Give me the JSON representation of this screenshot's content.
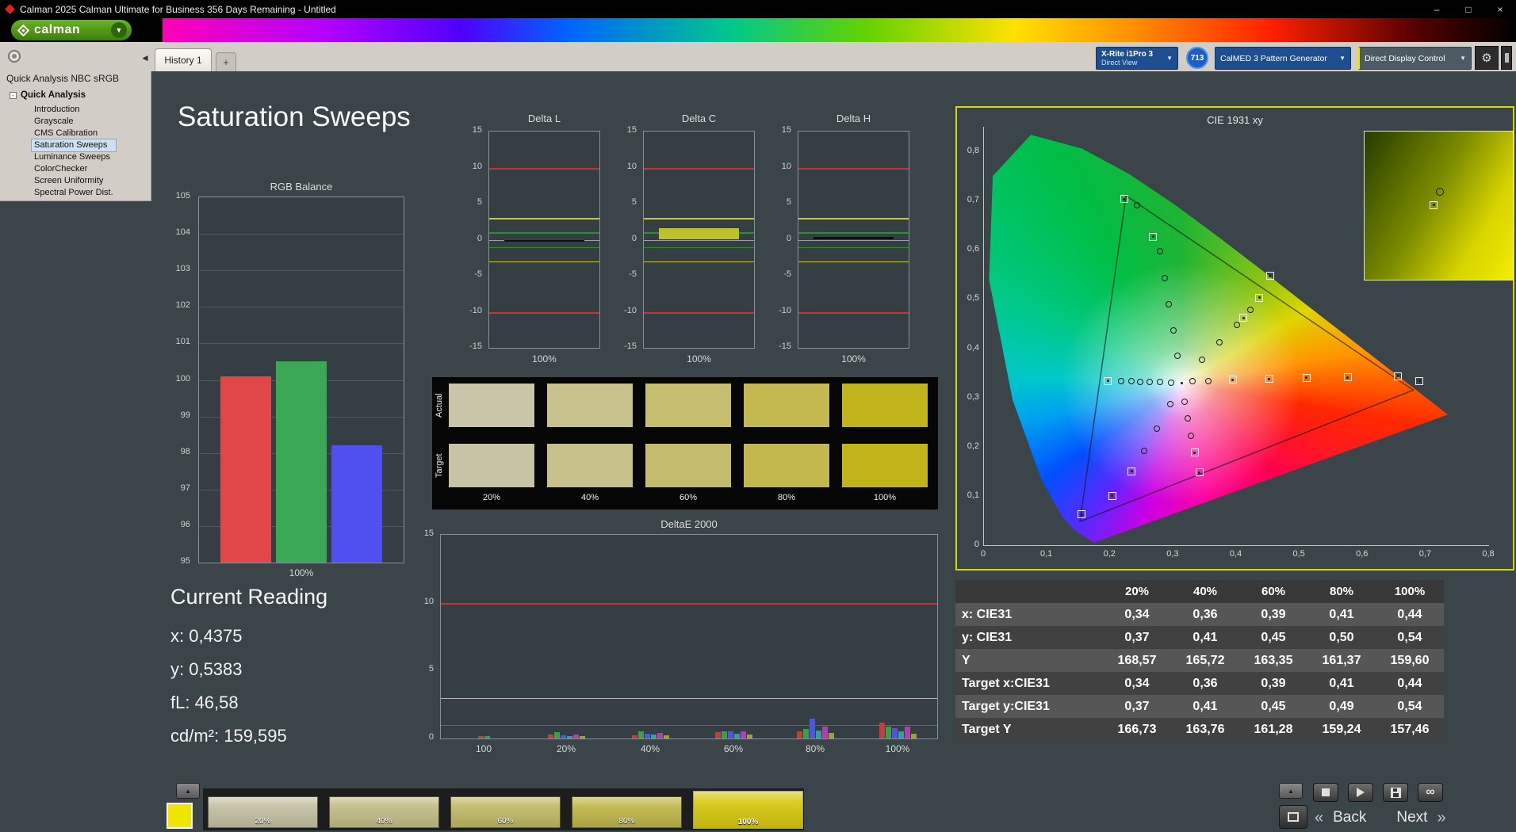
{
  "window": {
    "title": "Calman 2025 Calman Ultimate for Business 356 Days Remaining  - Untitled",
    "minimize": "–",
    "maximize": "□",
    "close": "×"
  },
  "brand": {
    "name": "calman"
  },
  "tabs": {
    "active": "History 1",
    "add": "+"
  },
  "toolbar": {
    "meter_line1": "X-Rite i1Pro 3",
    "meter_line2": "Direct View",
    "meter_badge": "713",
    "pattern_generator": "CalMED 3 Pattern Generator",
    "display_control": "Direct Display Control"
  },
  "glyphs": {
    "caret": "▼",
    "collapse_left": "◄",
    "up_arrow": "▲",
    "infinity": "∞",
    "back_chevron": "«",
    "next_chevron": "»",
    "tree_expander": "-",
    "gear": "⚙"
  },
  "sidebar": {
    "header": "Quick Analysis NBC sRGB",
    "root": "Quick Analysis",
    "items": [
      "Introduction",
      "Grayscale",
      "CMS Calibration",
      "Saturation Sweeps",
      "Luminance Sweeps",
      "ColorChecker",
      "Screen Uniformity",
      "Spectral Power Dist."
    ],
    "selected": "Saturation Sweeps"
  },
  "page": {
    "title": "Saturation Sweeps"
  },
  "current_reading": {
    "heading": "Current Reading",
    "lines": [
      "x: 0,4375",
      "y: 0,5383",
      "fL: 46,58",
      "cd/m²: 159,595"
    ]
  },
  "swatch_panel": {
    "row_labels": [
      "Actual",
      "Target"
    ],
    "col_labels": [
      "20%",
      "40%",
      "60%",
      "80%",
      "100%"
    ],
    "actual_colors": [
      "#c8c5a9",
      "#c7c18d",
      "#c5bd6f",
      "#c4b951",
      "#c2b41c"
    ],
    "target_colors": [
      "#c7c4a6",
      "#c6c08a",
      "#c4bc6c",
      "#c3b84e",
      "#c1b31a"
    ]
  },
  "measurement_table": {
    "columns": [
      "20%",
      "40%",
      "60%",
      "80%",
      "100%"
    ],
    "rows": [
      {
        "label": "x: CIE31",
        "values": [
          "0,34",
          "0,36",
          "0,39",
          "0,41",
          "0,44"
        ]
      },
      {
        "label": "y: CIE31",
        "values": [
          "0,37",
          "0,41",
          "0,45",
          "0,50",
          "0,54"
        ]
      },
      {
        "label": "Y",
        "values": [
          "168,57",
          "165,72",
          "163,35",
          "161,37",
          "159,60"
        ]
      },
      {
        "label": "Target x:CIE31",
        "values": [
          "0,34",
          "0,36",
          "0,39",
          "0,41",
          "0,44"
        ]
      },
      {
        "label": "Target y:CIE31",
        "values": [
          "0,37",
          "0,41",
          "0,45",
          "0,49",
          "0,54"
        ]
      },
      {
        "label": "Target Y",
        "values": [
          "166,73",
          "163,76",
          "161,28",
          "159,24",
          "157,46"
        ]
      }
    ]
  },
  "bottom_bar": {
    "swatch_color": "#efe600",
    "patches": [
      {
        "label": "20%",
        "color": "#c3c0a2",
        "selected": false
      },
      {
        "label": "40%",
        "color": "#c2bd85",
        "selected": false
      },
      {
        "label": "60%",
        "color": "#c0b967",
        "selected": false
      },
      {
        "label": "80%",
        "color": "#bfb54a",
        "selected": false
      },
      {
        "label": "100%",
        "color": "#d6c70e",
        "selected": true
      }
    ],
    "back": "Back",
    "next": "Next"
  },
  "chart_data": [
    {
      "id": "rgb_balance",
      "type": "bar",
      "title": "RGB Balance",
      "categories": [
        "Red",
        "Green",
        "Blue"
      ],
      "values": [
        100.1,
        100.5,
        98.2
      ],
      "colors": [
        "#e04848",
        "#3aa855",
        "#5050f0"
      ],
      "ylim": [
        95,
        105
      ],
      "yticks": [
        105,
        104,
        103,
        102,
        101,
        100,
        99,
        98,
        97,
        96,
        95
      ],
      "xlabel": "100%"
    },
    {
      "id": "delta_l",
      "type": "bar",
      "title": "Delta L",
      "ylim": [
        -15,
        15
      ],
      "yticks": [
        15,
        10,
        5,
        0,
        -5,
        -10,
        -15
      ],
      "limit_lines": [
        {
          "y": 10,
          "color": "#c83232"
        },
        {
          "y": -10,
          "color": "#c83232"
        },
        {
          "y": 3,
          "color": "#c8c832"
        },
        {
          "y": -3,
          "color": "#c8c832"
        },
        {
          "y": 1,
          "color": "#2e8b2e"
        },
        {
          "y": -1,
          "color": "#2e8b2e"
        }
      ],
      "value": -0.3,
      "bar_color": "#101010",
      "xlabel": "100%"
    },
    {
      "id": "delta_c",
      "type": "bar",
      "title": "Delta C",
      "ylim": [
        -15,
        15
      ],
      "yticks": [
        15,
        10,
        5,
        0,
        -5,
        -10,
        -15
      ],
      "limit_lines": [
        {
          "y": 10,
          "color": "#c83232"
        },
        {
          "y": -10,
          "color": "#c83232"
        },
        {
          "y": 3,
          "color": "#c8c832"
        },
        {
          "y": -3,
          "color": "#c8c832"
        },
        {
          "y": 1,
          "color": "#2e8b2e"
        },
        {
          "y": -1,
          "color": "#2e8b2e"
        }
      ],
      "value": 1.6,
      "bar_color": "#bcc22e",
      "xlabel": "100%"
    },
    {
      "id": "delta_h",
      "type": "bar",
      "title": "Delta H",
      "ylim": [
        -15,
        15
      ],
      "yticks": [
        15,
        10,
        5,
        0,
        -5,
        -10,
        -15
      ],
      "limit_lines": [
        {
          "y": 10,
          "color": "#c83232"
        },
        {
          "y": -10,
          "color": "#c83232"
        },
        {
          "y": 3,
          "color": "#c8c832"
        },
        {
          "y": -3,
          "color": "#c8c832"
        },
        {
          "y": 1,
          "color": "#2e8b2e"
        },
        {
          "y": -1,
          "color": "#2e8b2e"
        }
      ],
      "value": 0.4,
      "bar_color": "#101010",
      "xlabel": "100%"
    },
    {
      "id": "deltae_2000",
      "type": "grouped-bar",
      "title": "DeltaE 2000",
      "ylim": [
        0,
        15
      ],
      "yticks": [
        15,
        10,
        5,
        0
      ],
      "limit_lines": [
        {
          "y": 10,
          "color": "#c83232"
        },
        {
          "y": 3,
          "color": "#c8c832"
        },
        {
          "y": 1,
          "color": "#2e8b2e"
        }
      ],
      "categories": [
        "100",
        "20%",
        "40%",
        "60%",
        "80%",
        "100%"
      ],
      "series_colors": [
        "#c04040",
        "#40a040",
        "#4858e0",
        "#30a0a0",
        "#b040b0",
        "#a0a030",
        "#909090"
      ],
      "groups": [
        [
          0.15,
          0.2
        ],
        [
          0.3,
          0.45,
          0.25,
          0.2,
          0.3,
          0.2
        ],
        [
          0.25,
          0.5,
          0.35,
          0.3,
          0.4,
          0.25
        ],
        [
          0.45,
          0.5,
          0.55,
          0.35,
          0.5,
          0.3
        ],
        [
          0.55,
          0.7,
          1.45,
          0.6,
          0.85,
          0.4
        ],
        [
          1.15,
          0.85,
          0.75,
          0.55,
          0.9,
          0.35
        ]
      ]
    },
    {
      "id": "cie_1931",
      "type": "scatter",
      "title": "CIE 1931 xy",
      "xlim": [
        0,
        0.8
      ],
      "ylim": [
        0,
        0.8
      ],
      "xtick_labels": [
        "0",
        "0,1",
        "0,2",
        "0,3",
        "0,4",
        "0,5",
        "0,6",
        "0,7",
        "0,8"
      ],
      "ytick_labels": [
        "0",
        "0,1",
        "0,2",
        "0,3",
        "0,4",
        "0,5",
        "0,6",
        "0,7",
        "0,8"
      ],
      "white_point": {
        "x": 0.313,
        "y": 0.329
      },
      "gamut_triangle": [
        [
          0.225,
          0.71
        ],
        [
          0.68,
          0.315
        ],
        [
          0.152,
          0.048
        ]
      ],
      "measured_points": [
        [
          0.296,
          0.33
        ],
        [
          0.279,
          0.331
        ],
        [
          0.263,
          0.331
        ],
        [
          0.248,
          0.332
        ],
        [
          0.233,
          0.333
        ],
        [
          0.217,
          0.334
        ],
        [
          0.306,
          0.385
        ],
        [
          0.3,
          0.437
        ],
        [
          0.293,
          0.49
        ],
        [
          0.286,
          0.543
        ],
        [
          0.279,
          0.597
        ],
        [
          0.243,
          0.69
        ],
        [
          0.345,
          0.376
        ],
        [
          0.373,
          0.412
        ],
        [
          0.4,
          0.447
        ],
        [
          0.422,
          0.478
        ],
        [
          0.318,
          0.292
        ],
        [
          0.323,
          0.257
        ],
        [
          0.328,
          0.222
        ],
        [
          0.295,
          0.287
        ],
        [
          0.274,
          0.237
        ],
        [
          0.254,
          0.192
        ],
        [
          0.33,
          0.333
        ],
        [
          0.356,
          0.334
        ]
      ],
      "target_points": [
        [
          0.313,
          0.329
        ],
        [
          0.196,
          0.334
        ],
        [
          0.222,
          0.703
        ],
        [
          0.268,
          0.627
        ],
        [
          0.411,
          0.462
        ],
        [
          0.436,
          0.503
        ],
        [
          0.453,
          0.547
        ],
        [
          0.334,
          0.188
        ],
        [
          0.341,
          0.148
        ],
        [
          0.234,
          0.15
        ],
        [
          0.203,
          0.1
        ],
        [
          0.155,
          0.062
        ],
        [
          0.394,
          0.336
        ],
        [
          0.452,
          0.338
        ],
        [
          0.511,
          0.34
        ],
        [
          0.576,
          0.341
        ],
        [
          0.655,
          0.343
        ],
        [
          0.69,
          0.334
        ]
      ]
    }
  ]
}
